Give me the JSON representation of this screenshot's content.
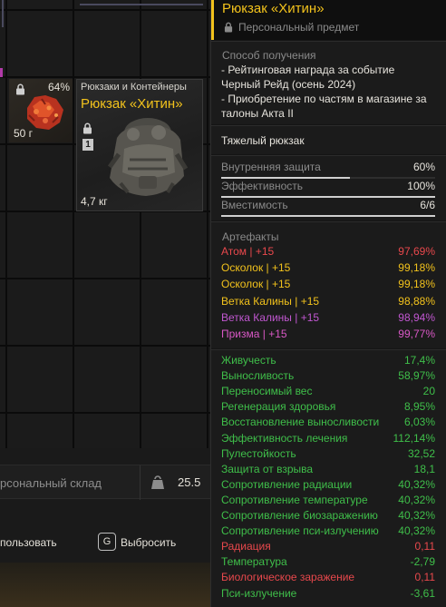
{
  "inventory": {
    "small_item": {
      "percent": "64%",
      "weight": "50 г"
    },
    "big_item": {
      "category": "Рюкзаки и Контейнеры",
      "name": "Рюкзак «Хитин»",
      "level": "1",
      "weight": "4,7 кг"
    },
    "stash": {
      "name": "рсональный склад",
      "weight": "25.5"
    },
    "actions": {
      "use_label": "пользовать",
      "drop_key": "G",
      "drop_label": "Выбросить"
    }
  },
  "tooltip": {
    "title": "Рюкзак «Хитин»",
    "subtitle": "Персональный предмет",
    "source_label": "Способ получения",
    "source_lines": [
      "- Рейтинговая награда за событие",
      "Черный Рейд (осень 2024)",
      "- Приобретение по частям в магазине за",
      "талоны Акта II"
    ],
    "type": "Тяжелый рюкзак",
    "stats": [
      {
        "label": "Внутренняя защита",
        "value": "60%",
        "fill": 0.6
      },
      {
        "label": "Эффективность",
        "value": "100%",
        "fill": 1.0
      },
      {
        "label": "Вместимость",
        "value": "6/6",
        "fill": 1.0
      }
    ],
    "artifacts_label": "Артефакты",
    "artifacts": [
      {
        "name": "Атом | +15",
        "value": "97,69%",
        "color": "#e8484c"
      },
      {
        "name": "Осколок | +15",
        "value": "99,18%",
        "color": "#f2c21c"
      },
      {
        "name": "Осколок | +15",
        "value": "99,18%",
        "color": "#f2c21c"
      },
      {
        "name": "Ветка Калины | +15",
        "value": "98,88%",
        "color": "#f2c21c"
      },
      {
        "name": "Ветка Калины | +15",
        "value": "98,94%",
        "color": "#c157d1"
      },
      {
        "name": "Призма | +15",
        "value": "99,77%",
        "color": "#d958c6"
      }
    ],
    "bonuses": [
      {
        "name": "Живучесть",
        "value": "17,4%",
        "color": "#3fbf4a"
      },
      {
        "name": "Выносливость",
        "value": "58,97%",
        "color": "#3fbf4a"
      },
      {
        "name": "Переносимый вес",
        "value": "20",
        "color": "#3fbf4a"
      },
      {
        "name": "Регенерация здоровья",
        "value": "8,95%",
        "color": "#3fbf4a"
      },
      {
        "name": "Восстановление выносливости",
        "value": "6,03%",
        "color": "#3fbf4a"
      },
      {
        "name": "Эффективность лечения",
        "value": "112,14%",
        "color": "#3fbf4a"
      },
      {
        "name": "Пулестойкость",
        "value": "32,52",
        "color": "#3fbf4a"
      },
      {
        "name": "Защита от взрыва",
        "value": "18,1",
        "color": "#3fbf4a"
      },
      {
        "name": "Сопротивление радиации",
        "value": "40,32%",
        "color": "#3fbf4a"
      },
      {
        "name": "Сопротивление температуре",
        "value": "40,32%",
        "color": "#3fbf4a"
      },
      {
        "name": "Сопротивление биозаражению",
        "value": "40,32%",
        "color": "#3fbf4a"
      },
      {
        "name": "Сопротивление пси-излучению",
        "value": "40,32%",
        "color": "#3fbf4a"
      },
      {
        "name": "Радиация",
        "value": "0,11",
        "color": "#e8484c"
      },
      {
        "name": "Температура",
        "value": "-2,79",
        "color": "#3fbf4a"
      },
      {
        "name": "Биологическое заражение",
        "value": "0,11",
        "color": "#e8484c"
      },
      {
        "name": "Пси-излучение",
        "value": "-3,61",
        "color": "#3fbf4a"
      }
    ]
  }
}
